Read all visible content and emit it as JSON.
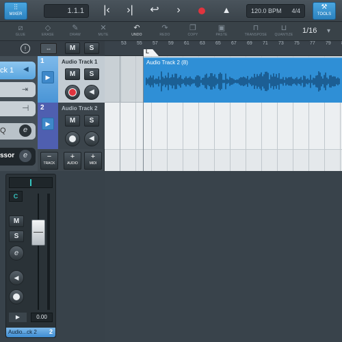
{
  "transport": {
    "mixer_label": "MIXER",
    "position": "1.1.1",
    "tempo": "120.0 BPM",
    "signature": "4/4",
    "tools_label": "TOOLS"
  },
  "toolbar": {
    "items": [
      {
        "label": "GLUE"
      },
      {
        "label": "ERASE"
      },
      {
        "label": "DRAW"
      },
      {
        "label": "MUTE"
      },
      {
        "label": "UNDO"
      },
      {
        "label": "REDO"
      },
      {
        "label": "COPY"
      },
      {
        "label": "PASTE"
      },
      {
        "label": "TRANSPOSE"
      },
      {
        "label": "QUANTIZE"
      }
    ],
    "quantize_value": "1/16"
  },
  "inspector": {
    "track_name": "ck 1",
    "effect_name": "ssor",
    "button_e": "e",
    "button_q": "Q"
  },
  "tracks": [
    {
      "number": "1",
      "name": "Audio Track 1",
      "mute": "M",
      "solo": "S"
    },
    {
      "number": "2",
      "name": "Audio Track 2",
      "mute": "M",
      "solo": "S"
    }
  ],
  "track_column_buttons": {
    "track": "TRACK",
    "audio": "AUDIO",
    "midi": "MIDI",
    "minus": "−",
    "plus": "+"
  },
  "ruler": {
    "ticks": [
      "53",
      "55",
      "57",
      "59",
      "61",
      "63",
      "65",
      "67",
      "69",
      "71",
      "73",
      "75",
      "77",
      "79",
      "81"
    ]
  },
  "locator": {
    "label": "L"
  },
  "event": {
    "label": "Audio Track 2 (8)"
  },
  "channel": {
    "pan": "C",
    "mute": "M",
    "solo": "S",
    "fx": "e",
    "volume": "0.00",
    "name": "Audio...ck 2",
    "number": "2"
  },
  "header_buttons": {
    "m": "M",
    "s": "S"
  },
  "colors": {
    "accent": "#2f8fd6",
    "track_blue": "#5aa0e0",
    "record": "#e0343e"
  }
}
